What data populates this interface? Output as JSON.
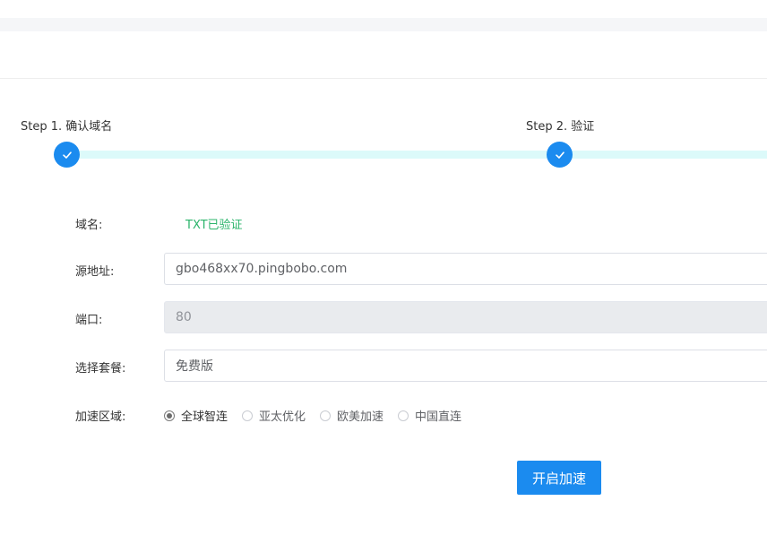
{
  "steps": [
    {
      "label": "Step 1. 确认域名",
      "status": "done"
    },
    {
      "label": "Step 2. 验证",
      "status": "done"
    }
  ],
  "form": {
    "domain_label": "域名:",
    "domain_status": "TXT已验证",
    "source_label": "源地址:",
    "source_value": "gbo468xx70.pingbobo.com",
    "port_label": "端口:",
    "port_value": "80",
    "plan_label": "选择套餐:",
    "plan_value": "免费版",
    "region_label": "加速区域:",
    "regions": [
      {
        "label": "全球智连",
        "checked": true
      },
      {
        "label": "亚太优化",
        "checked": false
      },
      {
        "label": "欧美加速",
        "checked": false
      },
      {
        "label": "中国直连",
        "checked": false
      }
    ],
    "submit_label": "开启加速"
  },
  "colors": {
    "primary": "#1b8bef",
    "success": "#2bb46b",
    "track": "#dcfafa"
  }
}
